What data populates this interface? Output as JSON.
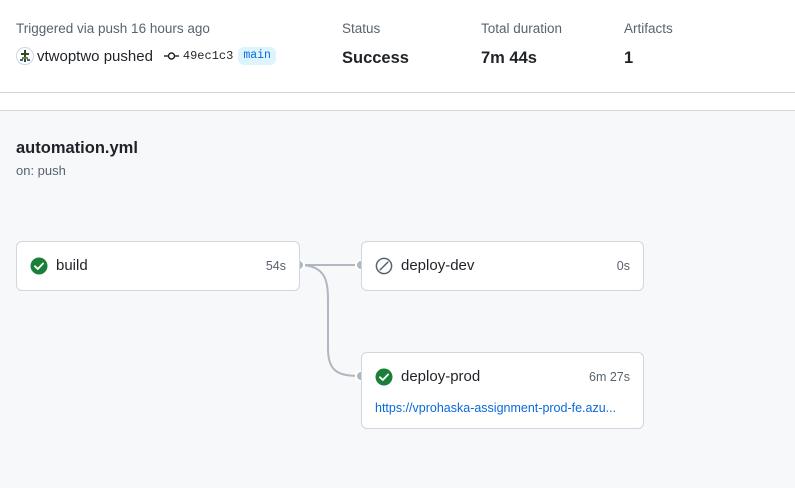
{
  "summary": {
    "trigger_label": "Triggered via push 16 hours ago",
    "actor": "vtwoptwo pushed",
    "commit_sha": "49ec1c3",
    "branch": "main",
    "status_label": "Status",
    "status_value": "Success",
    "duration_label": "Total duration",
    "duration_value": "7m 44s",
    "artifacts_label": "Artifacts",
    "artifacts_value": "1"
  },
  "workflow": {
    "file": "automation.yml",
    "trigger": "on: push"
  },
  "jobs": [
    {
      "name": "build",
      "duration": "54s",
      "status": "success",
      "icon": "check-circle-icon"
    },
    {
      "name": "deploy-dev",
      "duration": "0s",
      "status": "skipped",
      "icon": "skip-icon"
    },
    {
      "name": "deploy-prod",
      "duration": "6m 27s",
      "status": "success",
      "icon": "check-circle-icon",
      "link": "https://vprohaska-assignment-prod-fe.azu..."
    }
  ],
  "colors": {
    "success": "#1a7f37",
    "link": "#0969da",
    "muted": "#59636e",
    "border": "#d0d7de",
    "canvas": "#f6f8fa",
    "connector": "#afb8c1"
  }
}
